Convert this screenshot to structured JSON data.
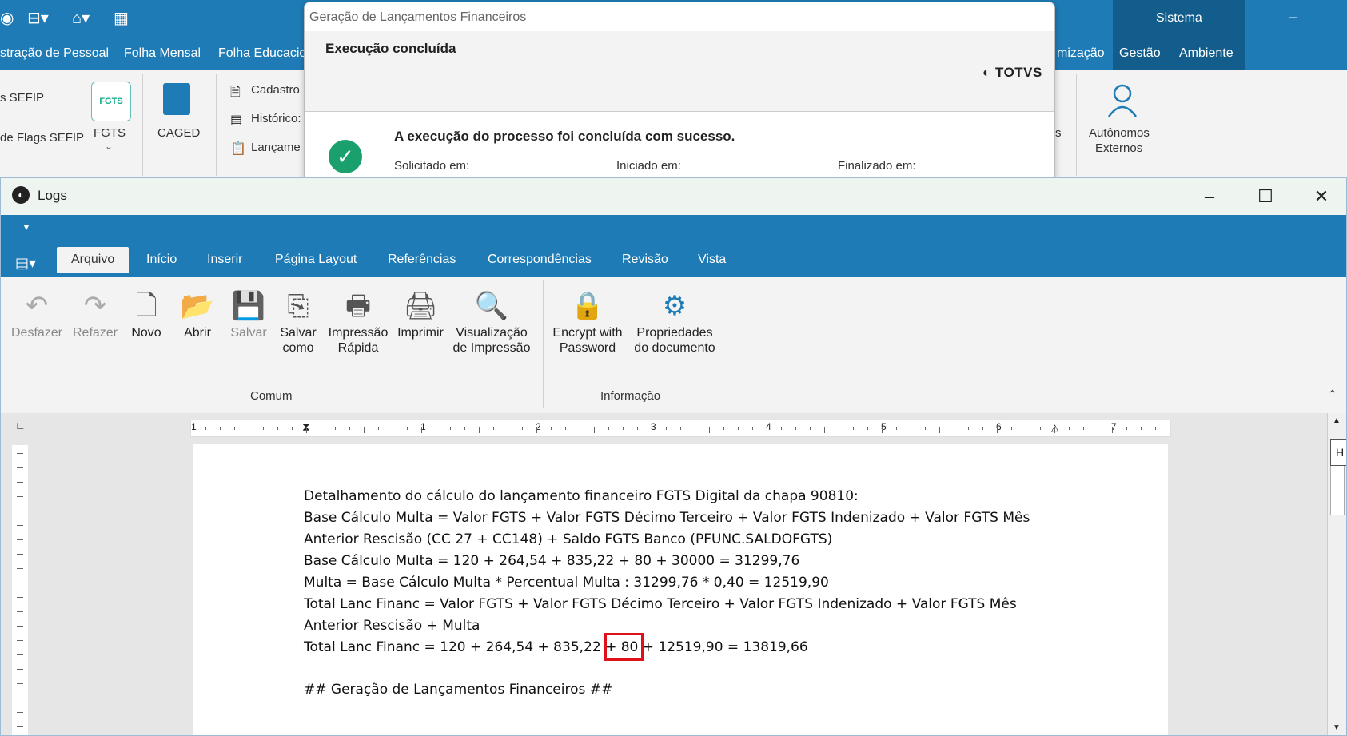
{
  "background_app": {
    "menu_items": [
      "stração de Pessoal",
      "Folha Mensal",
      "Folha Educacio",
      "mização",
      "Gestão",
      "Ambiente"
    ],
    "sistema_label": "Sistema",
    "ribbon": {
      "sefip": "s SEFIP",
      "flags_sefip": "de Flags SEFIP",
      "fgts_icon_text": "FGTS",
      "fgts": "FGTS",
      "caged": "CAGED",
      "cadastro": "Cadastro",
      "historicos": "Histórico:",
      "lancamentos": "Lançame",
      "autonomos": "Autônomos",
      "externos": "Externos",
      "s_frag": "s"
    }
  },
  "dialog": {
    "title": "Geração de Lançamentos Financeiros",
    "heading": "Execução concluída",
    "logo": "TOTVS",
    "message": "A execução do processo foi concluída com sucesso.",
    "solicitado_label": "Solicitado em:",
    "iniciado_label": "Iniciado em:",
    "finalizado_label": "Finalizado em:"
  },
  "logs_window": {
    "title": "Logs",
    "tabs": [
      "Arquivo",
      "Início",
      "Inserir",
      "Página Layout",
      "Referências",
      "Correspondências",
      "Revisão",
      "Vista"
    ],
    "active_tab": "Arquivo",
    "ribbon": {
      "desfazer": "Desfazer",
      "refazer": "Refazer",
      "novo": "Novo",
      "abrir": "Abrir",
      "salvar": "Salvar",
      "salvar_como_1": "Salvar",
      "salvar_como_2": "como",
      "impressao_rapida_1": "Impressão",
      "impressao_rapida_2": "Rápida",
      "imprimir": "Imprimir",
      "visualizacao_1": "Visualização",
      "visualizacao_2": "de Impressão",
      "encrypt_1": "Encrypt with",
      "encrypt_2": "Password",
      "propriedades_1": "Propriedades",
      "propriedades_2": "do documento",
      "group_comum": "Comum",
      "group_informacao": "Informação"
    },
    "ruler_numbers": [
      "1",
      "1",
      "2",
      "3",
      "4",
      "5",
      "6",
      "7"
    ],
    "side_tab": "H",
    "document_lines": [
      "Detalhamento do cálculo do lançamento financeiro FGTS Digital da chapa 90810:",
      "Base Cálculo Multa = Valor FGTS + Valor FGTS Décimo Terceiro + Valor FGTS Indenizado + Valor FGTS Mês",
      "Anterior Rescisão (CC 27 + CC148) + Saldo FGTS Banco (PFUNC.SALDOFGTS)",
      "Base Cálculo Multa = 120 + 264,54 + 835,22 + 80 + 30000 = 31299,76",
      " Multa = Base Cálculo Multa * Percentual Multa : 31299,76 * 0,40 = 12519,90",
      "Total Lanc Financ = Valor FGTS + Valor FGTS Décimo Terceiro + Valor FGTS Indenizado + Valor FGTS Mês",
      "Anterior Rescisão + Multa",
      "Total Lanc Financ = 120 + 264,54 + 835,22 + 80 + 12519,90 = 13819,66",
      "",
      "## Geração de Lançamentos Financeiros ##"
    ]
  }
}
